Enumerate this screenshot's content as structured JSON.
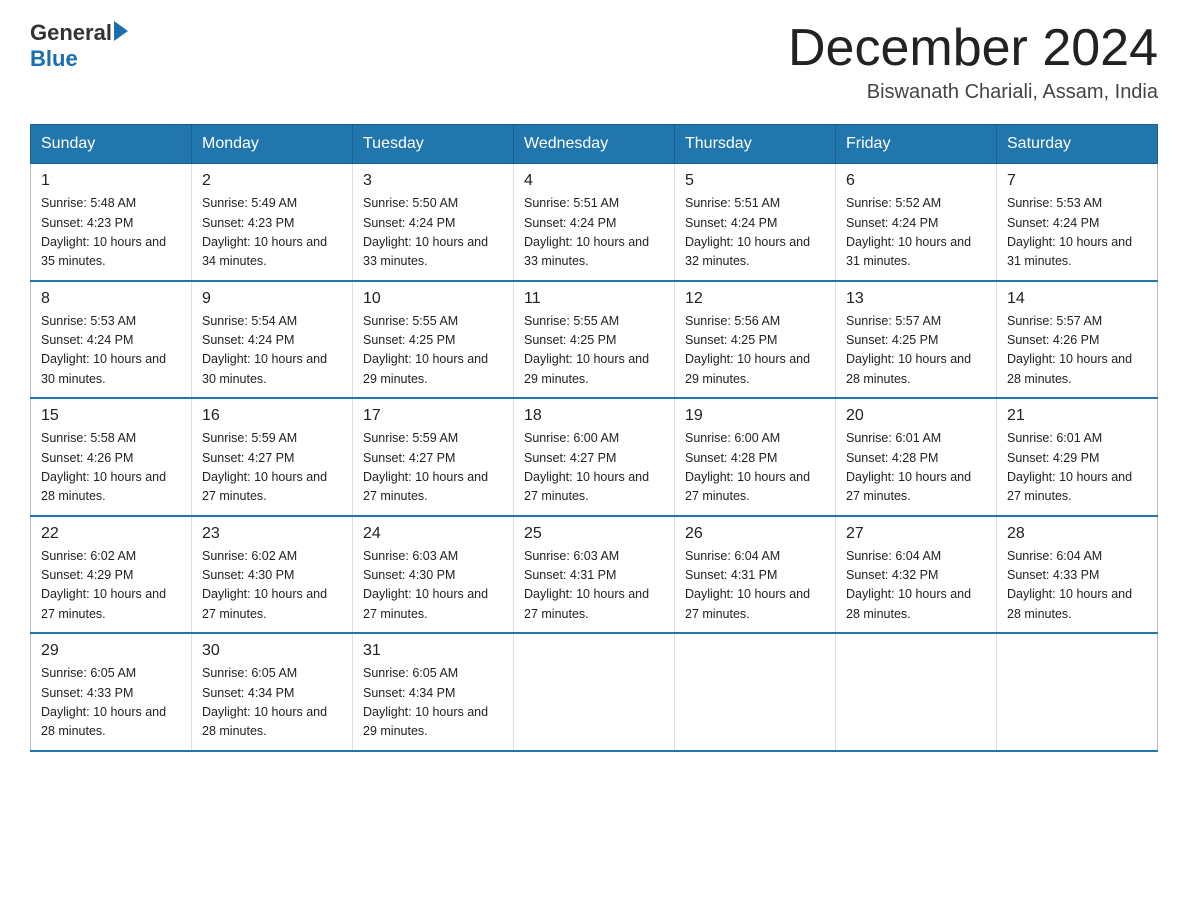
{
  "logo": {
    "general": "General",
    "blue": "Blue"
  },
  "title": "December 2024",
  "subtitle": "Biswanath Chariali, Assam, India",
  "headers": [
    "Sunday",
    "Monday",
    "Tuesday",
    "Wednesday",
    "Thursday",
    "Friday",
    "Saturday"
  ],
  "weeks": [
    [
      {
        "day": "1",
        "sunrise": "5:48 AM",
        "sunset": "4:23 PM",
        "daylight": "10 hours and 35 minutes."
      },
      {
        "day": "2",
        "sunrise": "5:49 AM",
        "sunset": "4:23 PM",
        "daylight": "10 hours and 34 minutes."
      },
      {
        "day": "3",
        "sunrise": "5:50 AM",
        "sunset": "4:24 PM",
        "daylight": "10 hours and 33 minutes."
      },
      {
        "day": "4",
        "sunrise": "5:51 AM",
        "sunset": "4:24 PM",
        "daylight": "10 hours and 33 minutes."
      },
      {
        "day": "5",
        "sunrise": "5:51 AM",
        "sunset": "4:24 PM",
        "daylight": "10 hours and 32 minutes."
      },
      {
        "day": "6",
        "sunrise": "5:52 AM",
        "sunset": "4:24 PM",
        "daylight": "10 hours and 31 minutes."
      },
      {
        "day": "7",
        "sunrise": "5:53 AM",
        "sunset": "4:24 PM",
        "daylight": "10 hours and 31 minutes."
      }
    ],
    [
      {
        "day": "8",
        "sunrise": "5:53 AM",
        "sunset": "4:24 PM",
        "daylight": "10 hours and 30 minutes."
      },
      {
        "day": "9",
        "sunrise": "5:54 AM",
        "sunset": "4:24 PM",
        "daylight": "10 hours and 30 minutes."
      },
      {
        "day": "10",
        "sunrise": "5:55 AM",
        "sunset": "4:25 PM",
        "daylight": "10 hours and 29 minutes."
      },
      {
        "day": "11",
        "sunrise": "5:55 AM",
        "sunset": "4:25 PM",
        "daylight": "10 hours and 29 minutes."
      },
      {
        "day": "12",
        "sunrise": "5:56 AM",
        "sunset": "4:25 PM",
        "daylight": "10 hours and 29 minutes."
      },
      {
        "day": "13",
        "sunrise": "5:57 AM",
        "sunset": "4:25 PM",
        "daylight": "10 hours and 28 minutes."
      },
      {
        "day": "14",
        "sunrise": "5:57 AM",
        "sunset": "4:26 PM",
        "daylight": "10 hours and 28 minutes."
      }
    ],
    [
      {
        "day": "15",
        "sunrise": "5:58 AM",
        "sunset": "4:26 PM",
        "daylight": "10 hours and 28 minutes."
      },
      {
        "day": "16",
        "sunrise": "5:59 AM",
        "sunset": "4:27 PM",
        "daylight": "10 hours and 27 minutes."
      },
      {
        "day": "17",
        "sunrise": "5:59 AM",
        "sunset": "4:27 PM",
        "daylight": "10 hours and 27 minutes."
      },
      {
        "day": "18",
        "sunrise": "6:00 AM",
        "sunset": "4:27 PM",
        "daylight": "10 hours and 27 minutes."
      },
      {
        "day": "19",
        "sunrise": "6:00 AM",
        "sunset": "4:28 PM",
        "daylight": "10 hours and 27 minutes."
      },
      {
        "day": "20",
        "sunrise": "6:01 AM",
        "sunset": "4:28 PM",
        "daylight": "10 hours and 27 minutes."
      },
      {
        "day": "21",
        "sunrise": "6:01 AM",
        "sunset": "4:29 PM",
        "daylight": "10 hours and 27 minutes."
      }
    ],
    [
      {
        "day": "22",
        "sunrise": "6:02 AM",
        "sunset": "4:29 PM",
        "daylight": "10 hours and 27 minutes."
      },
      {
        "day": "23",
        "sunrise": "6:02 AM",
        "sunset": "4:30 PM",
        "daylight": "10 hours and 27 minutes."
      },
      {
        "day": "24",
        "sunrise": "6:03 AM",
        "sunset": "4:30 PM",
        "daylight": "10 hours and 27 minutes."
      },
      {
        "day": "25",
        "sunrise": "6:03 AM",
        "sunset": "4:31 PM",
        "daylight": "10 hours and 27 minutes."
      },
      {
        "day": "26",
        "sunrise": "6:04 AM",
        "sunset": "4:31 PM",
        "daylight": "10 hours and 27 minutes."
      },
      {
        "day": "27",
        "sunrise": "6:04 AM",
        "sunset": "4:32 PM",
        "daylight": "10 hours and 28 minutes."
      },
      {
        "day": "28",
        "sunrise": "6:04 AM",
        "sunset": "4:33 PM",
        "daylight": "10 hours and 28 minutes."
      }
    ],
    [
      {
        "day": "29",
        "sunrise": "6:05 AM",
        "sunset": "4:33 PM",
        "daylight": "10 hours and 28 minutes."
      },
      {
        "day": "30",
        "sunrise": "6:05 AM",
        "sunset": "4:34 PM",
        "daylight": "10 hours and 28 minutes."
      },
      {
        "day": "31",
        "sunrise": "6:05 AM",
        "sunset": "4:34 PM",
        "daylight": "10 hours and 29 minutes."
      },
      null,
      null,
      null,
      null
    ]
  ]
}
